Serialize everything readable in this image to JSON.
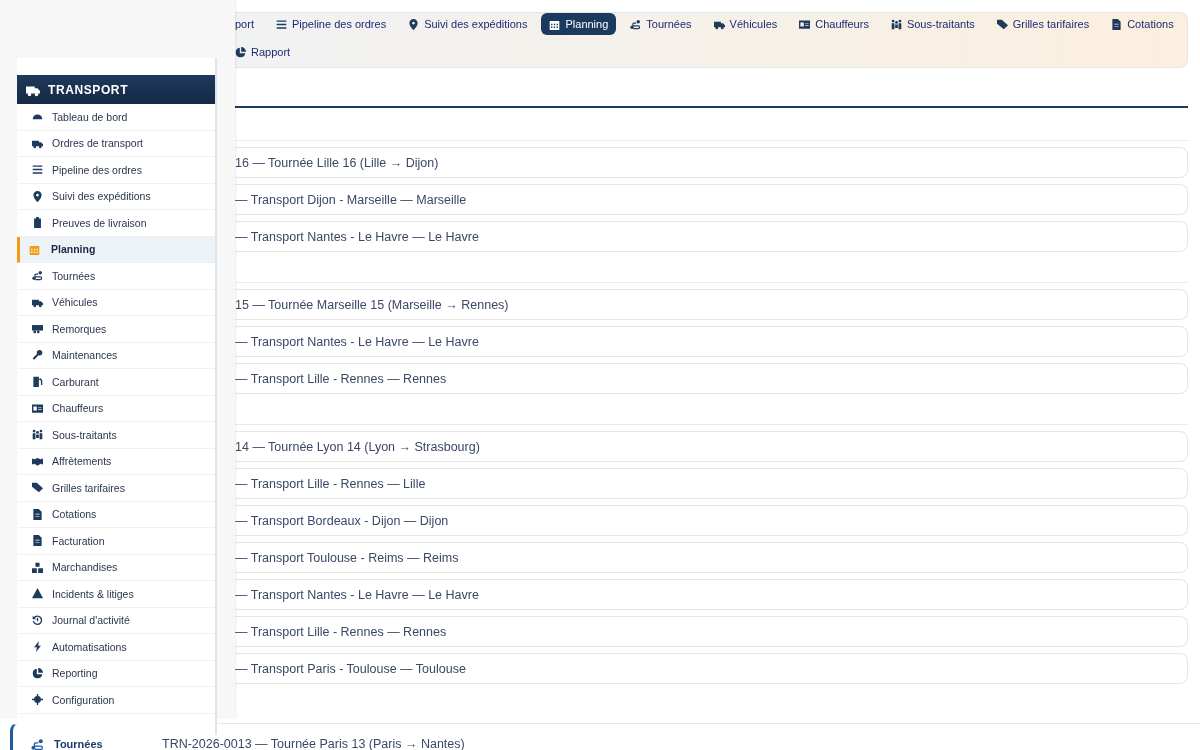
{
  "top_nav": {
    "rows": [
      {
        "items": [
          {
            "label": "port",
            "selected": false
          },
          {
            "label": "Pipeline des ordres",
            "selected": false
          },
          {
            "label": "Suivi des expéditions",
            "selected": false
          },
          {
            "label": "Planning",
            "selected": true
          },
          {
            "label": "Tournées",
            "selected": false
          },
          {
            "label": "Véhicules",
            "selected": false
          },
          {
            "label": "Chauffeurs",
            "selected": false
          },
          {
            "label": "Sous-traitants",
            "selected": false
          },
          {
            "label": "Grilles tarifaires",
            "selected": false
          },
          {
            "label": "Cotations",
            "selected": false
          }
        ]
      },
      {
        "items": [
          {
            "label": "Rapport",
            "selected": false
          }
        ]
      }
    ]
  },
  "sidebar": {
    "title": "TRANSPORT",
    "items": [
      {
        "label": "Tableau de bord",
        "selected": false
      },
      {
        "label": "Ordres de transport",
        "selected": false
      },
      {
        "label": "Pipeline des ordres",
        "selected": false
      },
      {
        "label": "Suivi des expéditions",
        "selected": false
      },
      {
        "label": "Preuves de livraison",
        "selected": false
      },
      {
        "label": "Planning",
        "selected": true
      },
      {
        "label": "Tournées",
        "selected": false
      },
      {
        "label": "Véhicules",
        "selected": false
      },
      {
        "label": "Remorques",
        "selected": false
      },
      {
        "label": "Maintenances",
        "selected": false
      },
      {
        "label": "Carburant",
        "selected": false
      },
      {
        "label": "Chauffeurs",
        "selected": false
      },
      {
        "label": "Sous-traitants",
        "selected": false
      },
      {
        "label": "Affrètements",
        "selected": false
      },
      {
        "label": "Grilles tarifaires",
        "selected": false
      },
      {
        "label": "Cotations",
        "selected": false
      },
      {
        "label": "Facturation",
        "selected": false
      },
      {
        "label": "Marchandises",
        "selected": false
      },
      {
        "label": "Incidents & litiges",
        "selected": false
      },
      {
        "label": "Journal d'activité",
        "selected": false
      },
      {
        "label": "Automatisations",
        "selected": false
      },
      {
        "label": "Reporting",
        "selected": false
      },
      {
        "label": "Configuration",
        "selected": false
      }
    ]
  },
  "groups": [
    {
      "rows": [
        "16 — Tournée Lille 16 (Lille → Dijon)",
        "— Transport Dijon - Marseille — Marseille",
        "— Transport Nantes - Le Havre — Le Havre"
      ]
    },
    {
      "rows": [
        "15 — Tournée Marseille 15 (Marseille → Rennes)",
        "— Transport Nantes - Le Havre — Le Havre",
        "— Transport Lille - Rennes — Rennes"
      ]
    },
    {
      "rows": [
        "14 — Tournée Lyon 14 (Lyon → Strasbourg)",
        "— Transport Lille - Rennes — Lille",
        "— Transport Bordeaux - Dijon — Dijon",
        "— Transport Toulouse - Reims — Reims",
        "— Transport Nantes - Le Havre — Le Havre",
        "— Transport Lille - Rennes — Rennes",
        "— Transport Paris - Toulouse — Toulouse"
      ]
    }
  ],
  "bottom_row": {
    "label": "Tournées",
    "text": "TRN-2026-0013 — Tournée Paris 13 (Paris → Nantes)"
  }
}
